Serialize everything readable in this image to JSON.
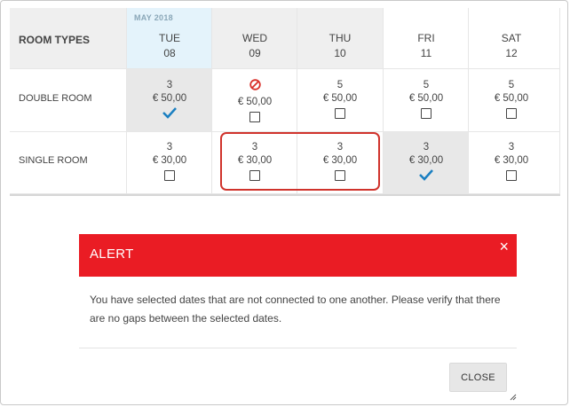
{
  "grid": {
    "header_room_types": "ROOM TYPES",
    "month_label": "MAY 2018",
    "days": [
      {
        "weekday": "TUE",
        "date": "08"
      },
      {
        "weekday": "WED",
        "date": "09"
      },
      {
        "weekday": "THU",
        "date": "10"
      },
      {
        "weekday": "FRI",
        "date": "11"
      },
      {
        "weekday": "SAT",
        "date": "12"
      }
    ],
    "rows": [
      {
        "label": "DOUBLE ROOM",
        "cells": [
          {
            "count": "3",
            "price": "€ 50,00",
            "state": "checked"
          },
          {
            "count": "",
            "price": "€ 50,00",
            "state": "blocked"
          },
          {
            "count": "5",
            "price": "€ 50,00",
            "state": "unchecked"
          },
          {
            "count": "5",
            "price": "€ 50,00",
            "state": "unchecked"
          },
          {
            "count": "5",
            "price": "€ 50,00",
            "state": "unchecked"
          }
        ]
      },
      {
        "label": "SINGLE ROOM",
        "cells": [
          {
            "count": "3",
            "price": "€ 30,00",
            "state": "unchecked"
          },
          {
            "count": "3",
            "price": "€ 30,00",
            "state": "unchecked"
          },
          {
            "count": "3",
            "price": "€ 30,00",
            "state": "unchecked"
          },
          {
            "count": "3",
            "price": "€ 30,00",
            "state": "checked"
          },
          {
            "count": "3",
            "price": "€ 30,00",
            "state": "unchecked"
          }
        ]
      }
    ]
  },
  "alert": {
    "title": "ALERT",
    "close_icon": "×",
    "message": "You have selected dates that are not connected to one another. Please verify that there are no gaps between the selected dates.",
    "close_label": "CLOSE"
  },
  "colors": {
    "alert_red": "#ea1c24",
    "selected_header": "#e4f3fb",
    "check_blue": "#1a7fc1",
    "highlight_red": "#d0332c",
    "blocked_red": "#d9302a"
  },
  "icons": {
    "check": "checkmark-icon",
    "blocked": "no-entry-icon",
    "checkbox": "checkbox-icon",
    "close": "close-icon",
    "resize": "resize-handle-icon"
  }
}
